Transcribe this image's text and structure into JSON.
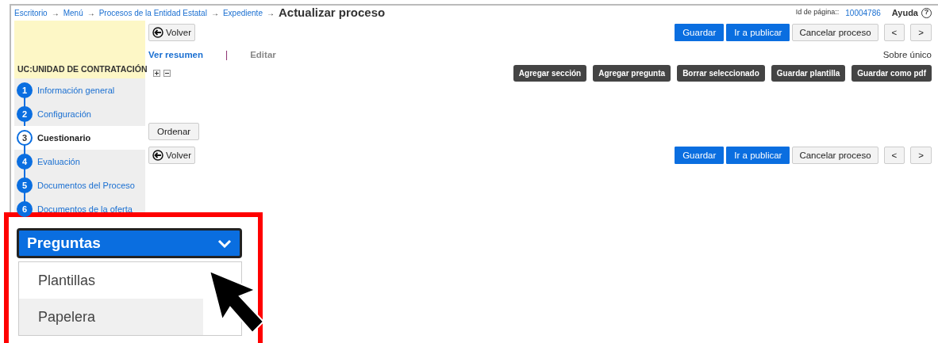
{
  "breadcrumb": [
    {
      "label": "Escritorio"
    },
    {
      "label": "Menú"
    },
    {
      "label": "Procesos de la Entidad Estatal"
    },
    {
      "label": "Expediente"
    }
  ],
  "breadcrumb_separator": "→",
  "page_title": "Actualizar proceso",
  "page_id": {
    "label": "Id de página::",
    "value": "10004786"
  },
  "help": {
    "label": "Ayuda",
    "icon": "?"
  },
  "sidebar": {
    "header": "UC:UNIDAD DE CONTRATACIÓN",
    "steps": [
      {
        "number": "1",
        "label": "Información general",
        "selected": false
      },
      {
        "number": "2",
        "label": "Configuración",
        "selected": false
      },
      {
        "number": "3",
        "label": "Cuestionario",
        "selected": true
      },
      {
        "number": "4",
        "label": "Evaluación",
        "selected": false
      },
      {
        "number": "5",
        "label": "Documentos del Proceso",
        "selected": false
      },
      {
        "number": "6",
        "label": "Documentos de la oferta",
        "selected": false
      }
    ]
  },
  "top_toolbar": {
    "back": "Volver",
    "actions": [
      {
        "label": "Guardar",
        "kind": "primary"
      },
      {
        "label": "Ir a publicar",
        "kind": "primary"
      },
      {
        "label": "Cancelar proceso",
        "kind": "secondary"
      },
      {
        "label": "<",
        "kind": "secondary"
      },
      {
        "label": ">",
        "kind": "secondary"
      }
    ]
  },
  "views": [
    {
      "label": "Ver resumen",
      "disabled": false
    },
    {
      "label": "Editar",
      "disabled": true
    }
  ],
  "views_separator": "|",
  "envelope": "Sobre único",
  "tree_controls": [
    {
      "kind": "expand"
    },
    {
      "kind": "collapse"
    }
  ],
  "question_tools": [
    "Agregar sección",
    "Agregar pregunta",
    "Borrar seleccionado",
    "Guardar plantilla",
    "Guardar como pdf"
  ],
  "sort_button": "Ordenar",
  "bottom_toolbar": {
    "back": "Volver",
    "actions": [
      {
        "label": "Guardar",
        "kind": "primary"
      },
      {
        "label": "Ir a publicar",
        "kind": "primary"
      },
      {
        "label": "Cancelar proceso",
        "kind": "secondary"
      },
      {
        "label": "<",
        "kind": "secondary"
      },
      {
        "label": ">",
        "kind": "secondary"
      }
    ]
  },
  "callout": {
    "dropdown": {
      "label": "Preguntas",
      "expanded": true
    },
    "items": [
      {
        "label": "Plantillas",
        "highlighted": false
      },
      {
        "label": "Papelera",
        "highlighted": true
      }
    ]
  }
}
